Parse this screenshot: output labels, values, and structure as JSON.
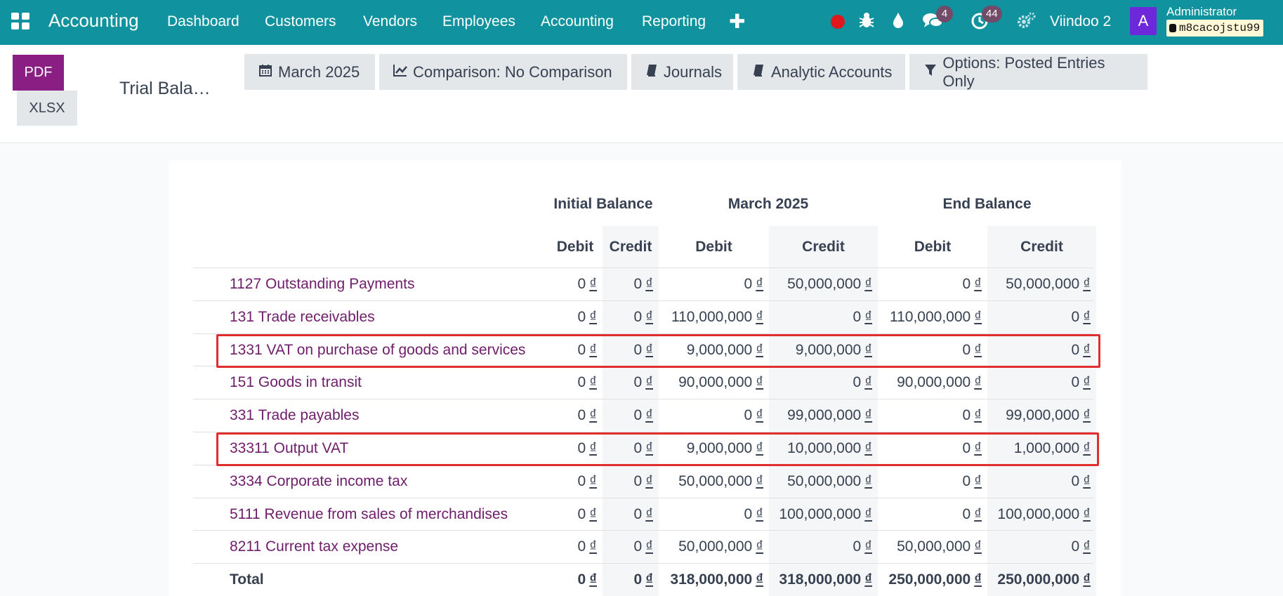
{
  "navbar": {
    "app_title": "Accounting",
    "menu": [
      "Dashboard",
      "Customers",
      "Vendors",
      "Employees",
      "Accounting",
      "Reporting"
    ],
    "add_icon": "plus-icon",
    "messages_count": "4",
    "activities_count": "44",
    "db_name": "Viindoo 2",
    "avatar_letter": "A",
    "user_name": "Administrator",
    "db_tag": "m8cacojstu99",
    "color": "#10939e"
  },
  "control_panel": {
    "pdf_label": "PDF",
    "xlsx_label": "XLSX",
    "title": "Trial Bala…",
    "filters": [
      {
        "icon": "calendar-icon",
        "label": "March 2025"
      },
      {
        "icon": "chart-line-icon",
        "label": "Comparison: No Comparison"
      },
      {
        "icon": "book-icon",
        "label": "Journals"
      },
      {
        "icon": "book-icon",
        "label": "Analytic Accounts"
      },
      {
        "icon": "filter-icon",
        "label": "Options: Posted Entries Only"
      }
    ]
  },
  "report": {
    "groups": [
      "Initial Balance",
      "March 2025",
      "End Balance"
    ],
    "columns": [
      "Debit",
      "Credit",
      "Debit",
      "Credit",
      "Debit",
      "Credit"
    ],
    "currency": "₫",
    "rows": [
      {
        "account": "1127 Outstanding Payments",
        "values": [
          "0",
          "0",
          "0",
          "50,000,000",
          "0",
          "50,000,000"
        ]
      },
      {
        "account": "131 Trade receivables",
        "values": [
          "0",
          "0",
          "110,000,000",
          "0",
          "110,000,000",
          "0"
        ]
      },
      {
        "account": "1331 VAT on purchase of goods and services",
        "values": [
          "0",
          "0",
          "9,000,000",
          "9,000,000",
          "0",
          "0"
        ]
      },
      {
        "account": "151 Goods in transit",
        "values": [
          "0",
          "0",
          "90,000,000",
          "0",
          "90,000,000",
          "0"
        ]
      },
      {
        "account": "331 Trade payables",
        "values": [
          "0",
          "0",
          "0",
          "99,000,000",
          "0",
          "99,000,000"
        ]
      },
      {
        "account": "33311 Output VAT",
        "values": [
          "0",
          "0",
          "9,000,000",
          "10,000,000",
          "0",
          "1,000,000"
        ]
      },
      {
        "account": "3334 Corporate income tax",
        "values": [
          "0",
          "0",
          "50,000,000",
          "50,000,000",
          "0",
          "0"
        ]
      },
      {
        "account": "5111 Revenue from sales of merchandises",
        "values": [
          "0",
          "0",
          "0",
          "100,000,000",
          "0",
          "100,000,000"
        ]
      },
      {
        "account": "8211 Current tax expense",
        "values": [
          "0",
          "0",
          "50,000,000",
          "0",
          "50,000,000",
          "0"
        ]
      }
    ],
    "total": {
      "account": "Total",
      "values": [
        "0",
        "0",
        "318,000,000",
        "318,000,000",
        "250,000,000",
        "250,000,000"
      ]
    },
    "highlighted_rows": [
      "1331 VAT on purchase of goods and services",
      "33311 Output VAT"
    ],
    "highlight_color": "#e02d2d",
    "link_color": "#6f1d6b"
  }
}
